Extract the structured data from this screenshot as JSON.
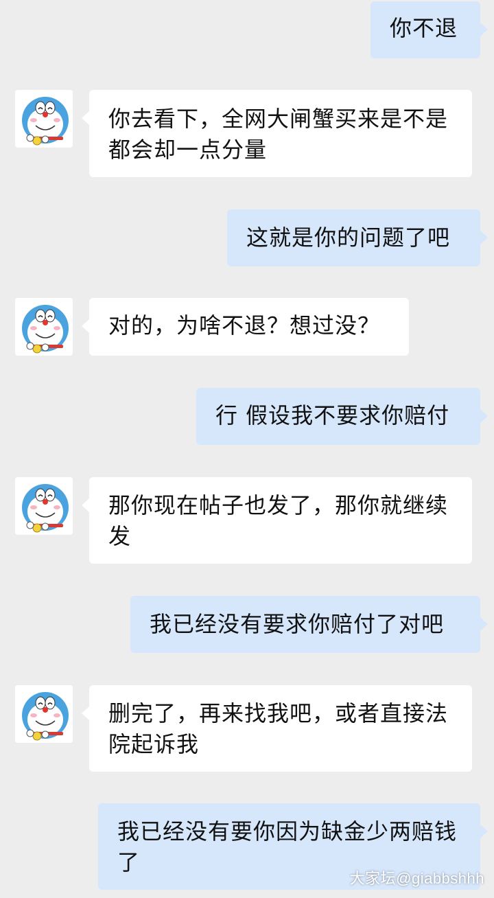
{
  "messages": [
    {
      "side": "out",
      "text": "你不退"
    },
    {
      "side": "in",
      "text": "你去看下，全网大闸蟹买来是不是都会却一点分量"
    },
    {
      "side": "out",
      "text": "这就是你的问题了吧"
    },
    {
      "side": "in",
      "text": "对的，为啥不退？想过没？"
    },
    {
      "side": "out",
      "text": "行 假设我不要求你赔付"
    },
    {
      "side": "in",
      "text": "那你现在帖子也发了，那你就继续发"
    },
    {
      "side": "out",
      "text": "我已经没有要求你赔付了对吧"
    },
    {
      "side": "in",
      "text": "删完了，再来找我吧，或者直接法院起诉我"
    },
    {
      "side": "out",
      "text": "我已经没有要你因为缺金少两赔钱了"
    }
  ],
  "avatar_icon": "doraemon-avatar-icon",
  "watermark": "大家坛@giabbshhh",
  "colors": {
    "background": "#ededed",
    "incoming_bubble": "#ffffff",
    "outgoing_bubble": "#d6e6fb"
  }
}
